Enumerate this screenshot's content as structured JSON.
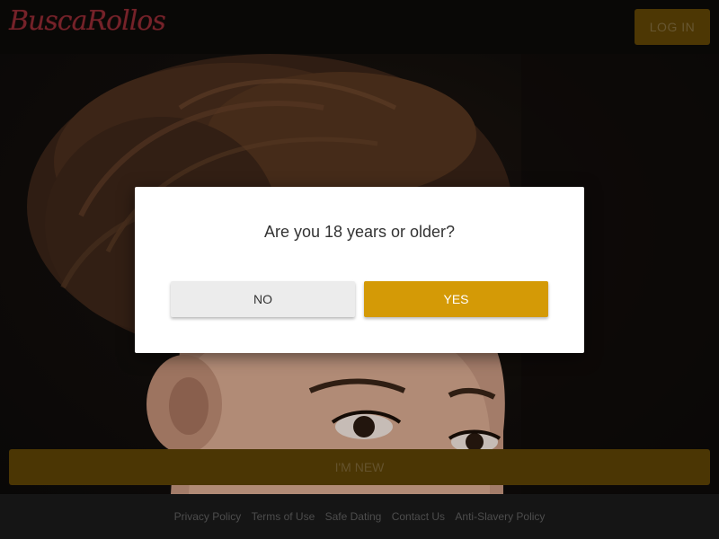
{
  "header": {
    "logo_text": "BuscaRollos",
    "login_label": "LOG IN"
  },
  "hero": {
    "signup_label": "I'M NEW"
  },
  "modal": {
    "question": "Are you 18 years or older?",
    "no_label": "NO",
    "yes_label": "YES"
  },
  "footer": {
    "links": [
      "Privacy Policy",
      "Terms of Use",
      "Safe Dating",
      "Contact Us",
      "Anti-Slavery Policy"
    ]
  },
  "colors": {
    "accent": "#d49a06",
    "logo": "#8f2a33",
    "header_bg": "#0c0a08",
    "footer_bg": "#1a1a1a"
  }
}
